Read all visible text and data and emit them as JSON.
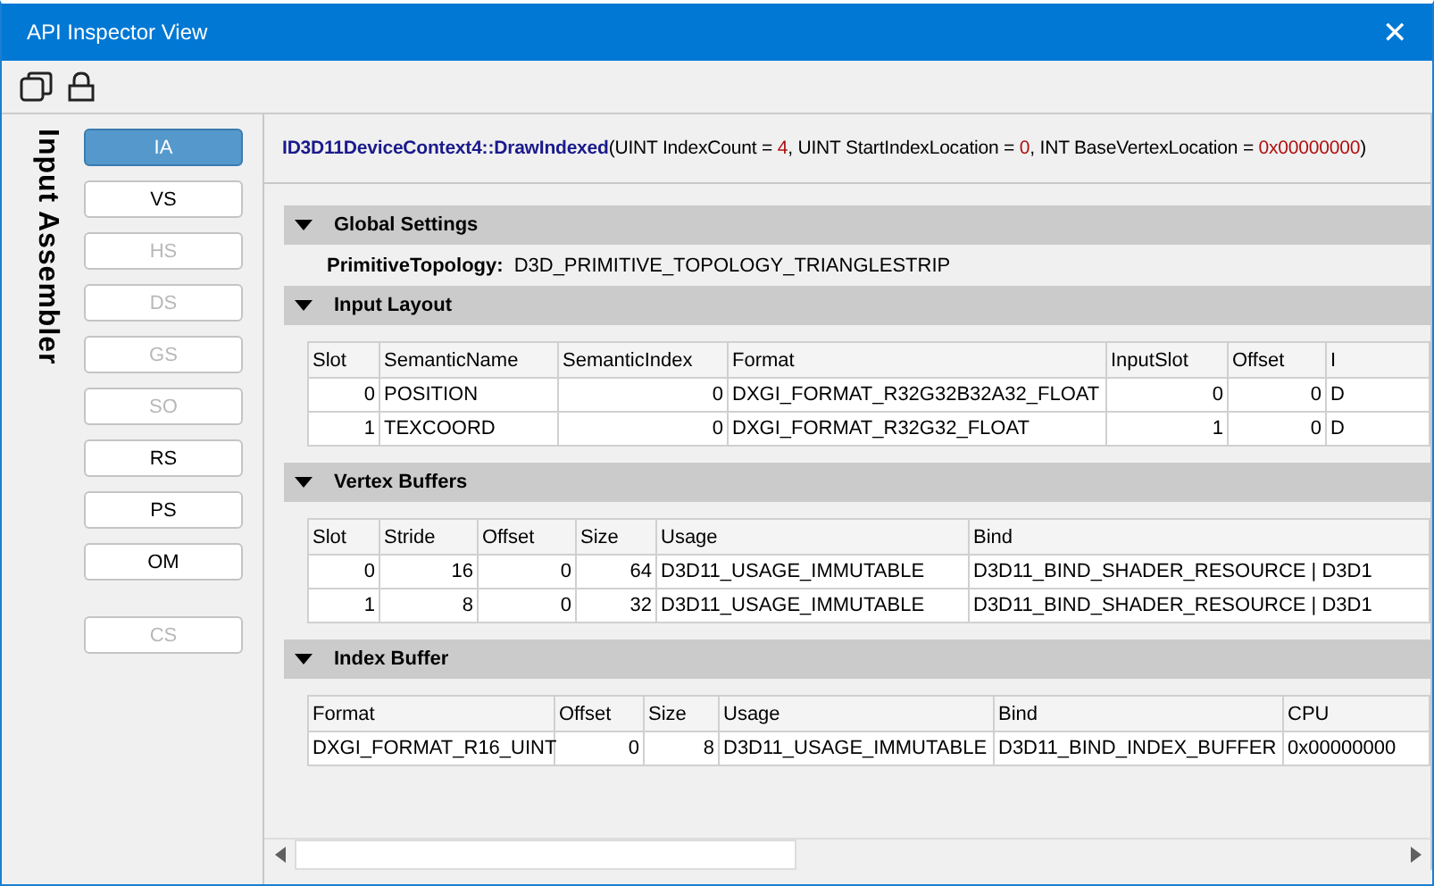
{
  "window": {
    "title": "API Inspector View",
    "close": "✕"
  },
  "sidebar": {
    "title": "Input Assembler",
    "stages": [
      {
        "label": "IA",
        "selected": true,
        "disabled": false,
        "kind": "stage"
      },
      {
        "label": "VS",
        "selected": false,
        "disabled": false,
        "kind": "stage"
      },
      {
        "label": "HS",
        "selected": false,
        "disabled": true,
        "kind": "stage"
      },
      {
        "label": "DS",
        "selected": false,
        "disabled": true,
        "kind": "stage"
      },
      {
        "label": "GS",
        "selected": false,
        "disabled": true,
        "kind": "stage"
      },
      {
        "label": "SO",
        "selected": false,
        "disabled": true,
        "kind": "stage"
      },
      {
        "label": "RS",
        "selected": false,
        "disabled": false,
        "kind": "stage"
      },
      {
        "label": "PS",
        "selected": false,
        "disabled": false,
        "kind": "stage"
      },
      {
        "label": "OM",
        "selected": false,
        "disabled": false,
        "kind": "stage"
      },
      {
        "label": "CS",
        "selected": false,
        "disabled": true,
        "kind": "compute"
      }
    ]
  },
  "call": [
    {
      "kind": "name",
      "text": "ID3D11DeviceContext4::DrawIndexed"
    },
    {
      "kind": "plain",
      "text": "(UINT IndexCount = "
    },
    {
      "kind": "value",
      "text": "4"
    },
    {
      "kind": "plain",
      "text": ", UINT StartIndexLocation = "
    },
    {
      "kind": "value",
      "text": "0"
    },
    {
      "kind": "plain",
      "text": ", INT BaseVertexLocation = "
    },
    {
      "kind": "value",
      "text": "0x00000000"
    },
    {
      "kind": "plain",
      "text": ")"
    }
  ],
  "sections": [
    {
      "title": "Global Settings",
      "expanded": true,
      "kind": "properties",
      "properties": [
        {
          "label": "PrimitiveTopology:",
          "value": "D3D_PRIMITIVE_TOPOLOGY_TRIANGLESTRIP"
        }
      ]
    },
    {
      "title": "Input Layout",
      "expanded": true,
      "kind": "table",
      "columns": [
        "Slot",
        "SemanticName",
        "SemanticIndex",
        "Format",
        "InputSlot",
        "Offset",
        "I"
      ],
      "rows": [
        [
          "0",
          "POSITION",
          "0",
          "DXGI_FORMAT_R32G32B32A32_FLOAT",
          "0",
          "0",
          "D"
        ],
        [
          "1",
          "TEXCOORD",
          "0",
          "DXGI_FORMAT_R32G32_FLOAT",
          "1",
          "0",
          "D"
        ]
      ]
    },
    {
      "title": "Vertex Buffers",
      "expanded": true,
      "kind": "table",
      "columns": [
        "Slot",
        "Stride",
        "Offset",
        "Size",
        "Usage",
        "Bind"
      ],
      "rows": [
        [
          "0",
          "16",
          "0",
          "64",
          "D3D11_USAGE_IMMUTABLE",
          "D3D11_BIND_SHADER_RESOURCE | D3D1"
        ],
        [
          "1",
          "8",
          "0",
          "32",
          "D3D11_USAGE_IMMUTABLE",
          "D3D11_BIND_SHADER_RESOURCE | D3D1"
        ]
      ]
    },
    {
      "title": "Index Buffer",
      "expanded": true,
      "kind": "table",
      "columns": [
        "Format",
        "Offset",
        "Size",
        "Usage",
        "Bind",
        "CPU"
      ],
      "rows": [
        [
          "DXGI_FORMAT_R16_UINT",
          "0",
          "8",
          "D3D11_USAGE_IMMUTABLE",
          "D3D11_BIND_INDEX_BUFFER",
          "0x00000000"
        ]
      ]
    }
  ]
}
